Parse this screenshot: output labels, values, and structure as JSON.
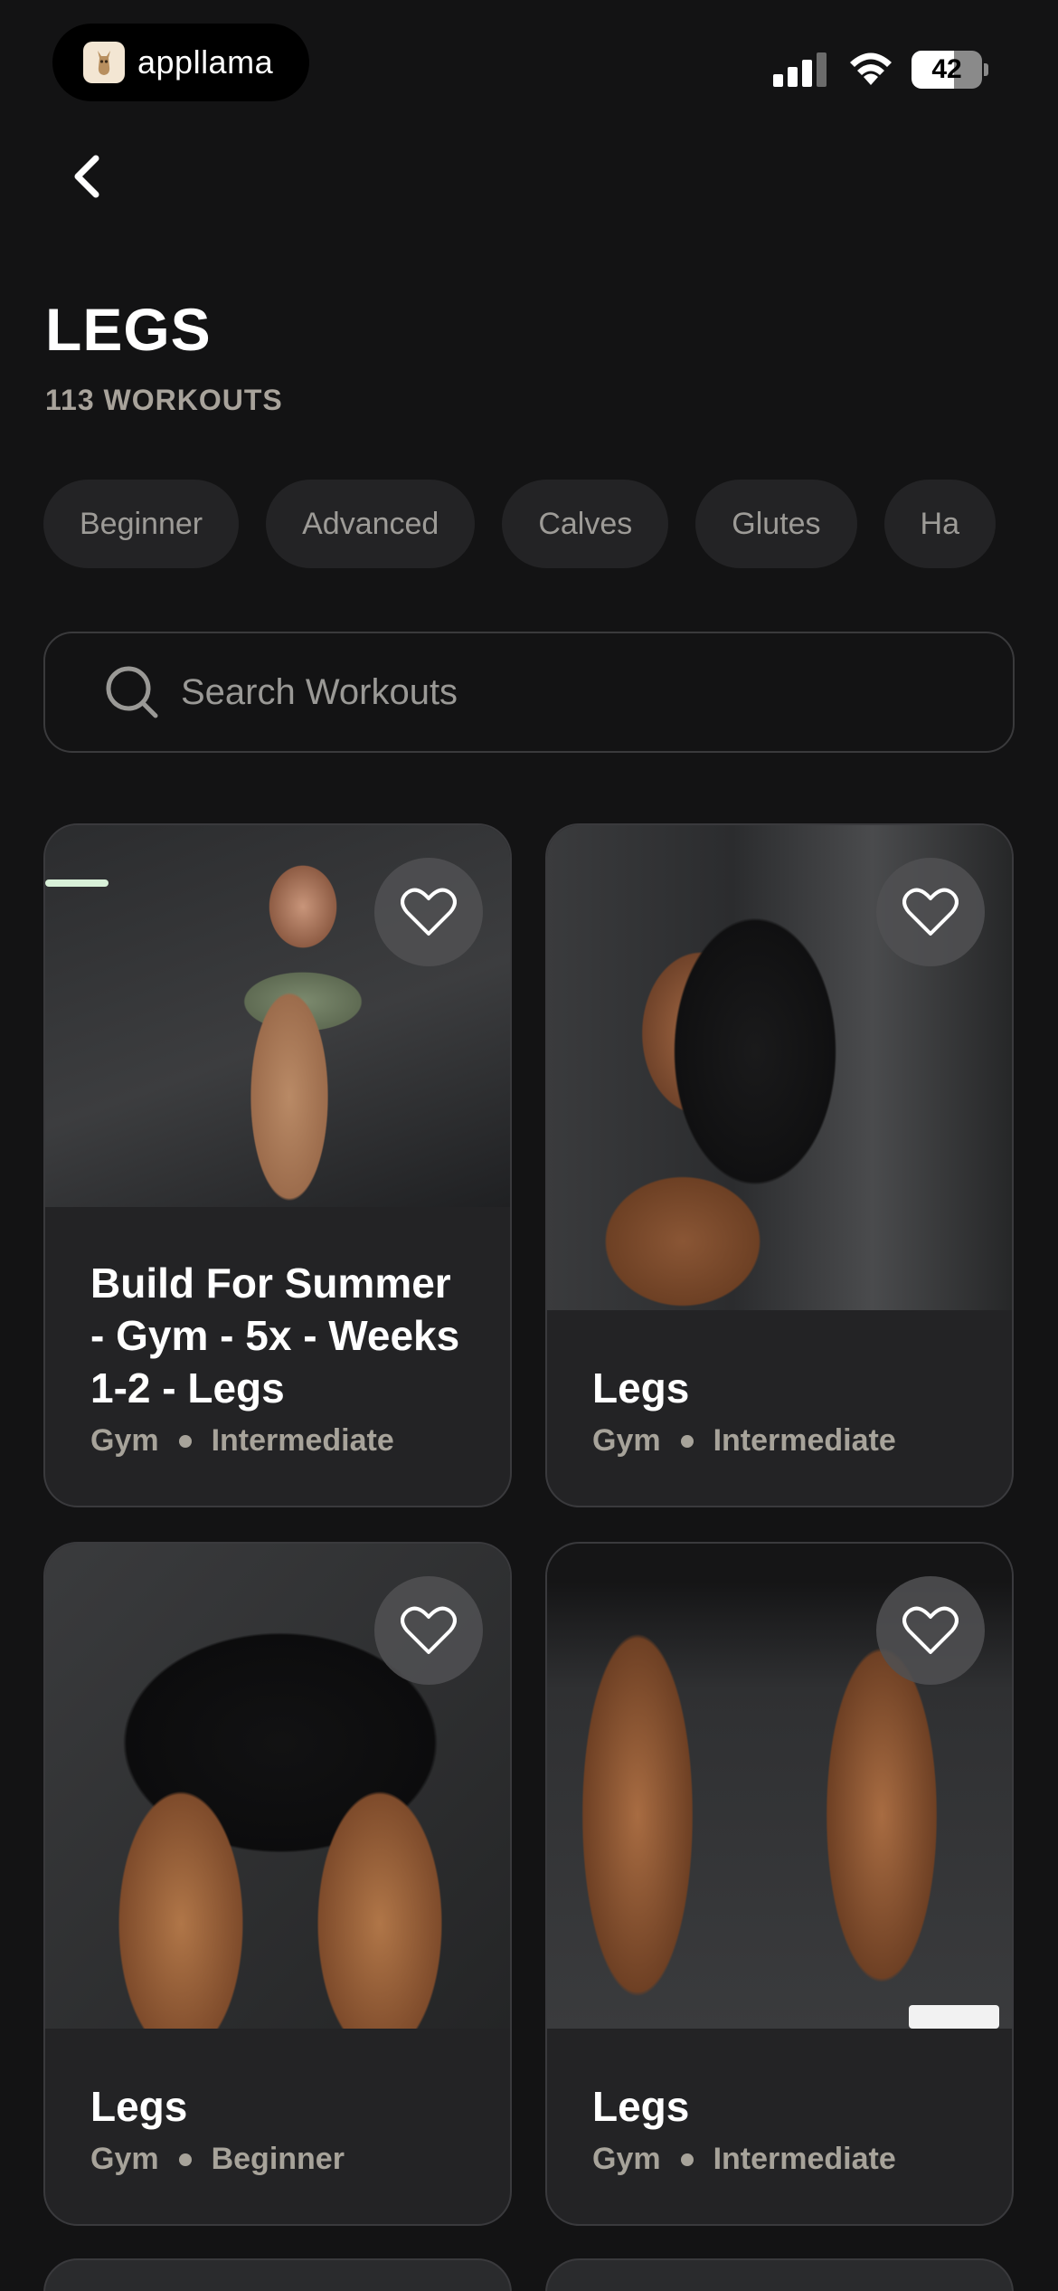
{
  "status_bar": {
    "app_name": "appllama",
    "battery": "42"
  },
  "header": {
    "title": "LEGS",
    "subtitle": "113 WORKOUTS"
  },
  "filters": [
    "Beginner",
    "Advanced",
    "Calves",
    "Glutes",
    "Ha"
  ],
  "search": {
    "placeholder": "Search Workouts"
  },
  "cards": [
    {
      "title": "Build For Summer - Gym - 5x - Weeks 1-2 - Legs",
      "location": "Gym",
      "level": "Intermediate"
    },
    {
      "title": "Legs",
      "location": "Gym",
      "level": "Intermediate"
    },
    {
      "title": "Legs",
      "location": "Gym",
      "level": "Beginner"
    },
    {
      "title": "Legs",
      "location": "Gym",
      "level": "Intermediate"
    }
  ],
  "icons": [
    "back-arrow-icon",
    "search-icon",
    "heart-icon",
    "signal-icon",
    "wifi-icon",
    "battery-icon",
    "appllama-logo-icon"
  ]
}
